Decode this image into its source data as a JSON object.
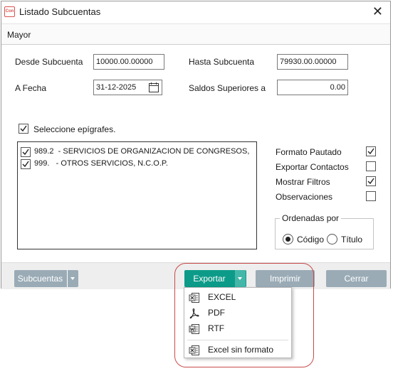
{
  "window": {
    "title": "Listado Subcuentas",
    "app_icon_text": "Con"
  },
  "menu": {
    "items": [
      "Mayor"
    ]
  },
  "form": {
    "desde_label": "Desde Subcuenta",
    "desde_value": "10000.00.00000",
    "hasta_label": "Hasta Subcuenta",
    "hasta_value": "79930.00.00000",
    "fecha_label": "A Fecha",
    "fecha_value": "31-12-2025",
    "saldos_label": "Saldos Superiores a",
    "saldos_value": "0.00",
    "seleccione_label": "Seleccione epígrafes.",
    "seleccione_checked": true
  },
  "epigrafes": [
    {
      "code": "989.2",
      "text": "- SERVICIOS DE ORGANIZACION DE CONGRESOS,",
      "checked": true
    },
    {
      "code": "999.",
      "text": " - OTROS SERVICIOS, N.C.O.P.",
      "checked": true
    }
  ],
  "options": [
    {
      "label": "Formato Pautado",
      "checked": true
    },
    {
      "label": "Exportar Contactos",
      "checked": false
    },
    {
      "label": "Mostrar Filtros",
      "checked": true
    },
    {
      "label": "Observaciones",
      "checked": false
    }
  ],
  "ordenadas": {
    "title": "Ordenadas por",
    "codigo_label": "Código",
    "titulo_label": "Título",
    "selected": "Código"
  },
  "footer": {
    "subcuentas_label": "Subcuentas",
    "exportar_label": "Exportar",
    "imprimir_label": "Imprimir",
    "cerrar_label": "Cerrar"
  },
  "export_menu": {
    "items": [
      {
        "label": "EXCEL",
        "icon": "excel-icon"
      },
      {
        "label": "PDF",
        "icon": "pdf-icon"
      },
      {
        "label": "RTF",
        "icon": "rtf-icon"
      },
      {
        "label": "Excel sin formato",
        "icon": "excel-icon"
      }
    ]
  },
  "colors": {
    "export_button": "#0d9b89",
    "secondary_button": "#9aabb6",
    "highlight": "#c84a4a"
  }
}
